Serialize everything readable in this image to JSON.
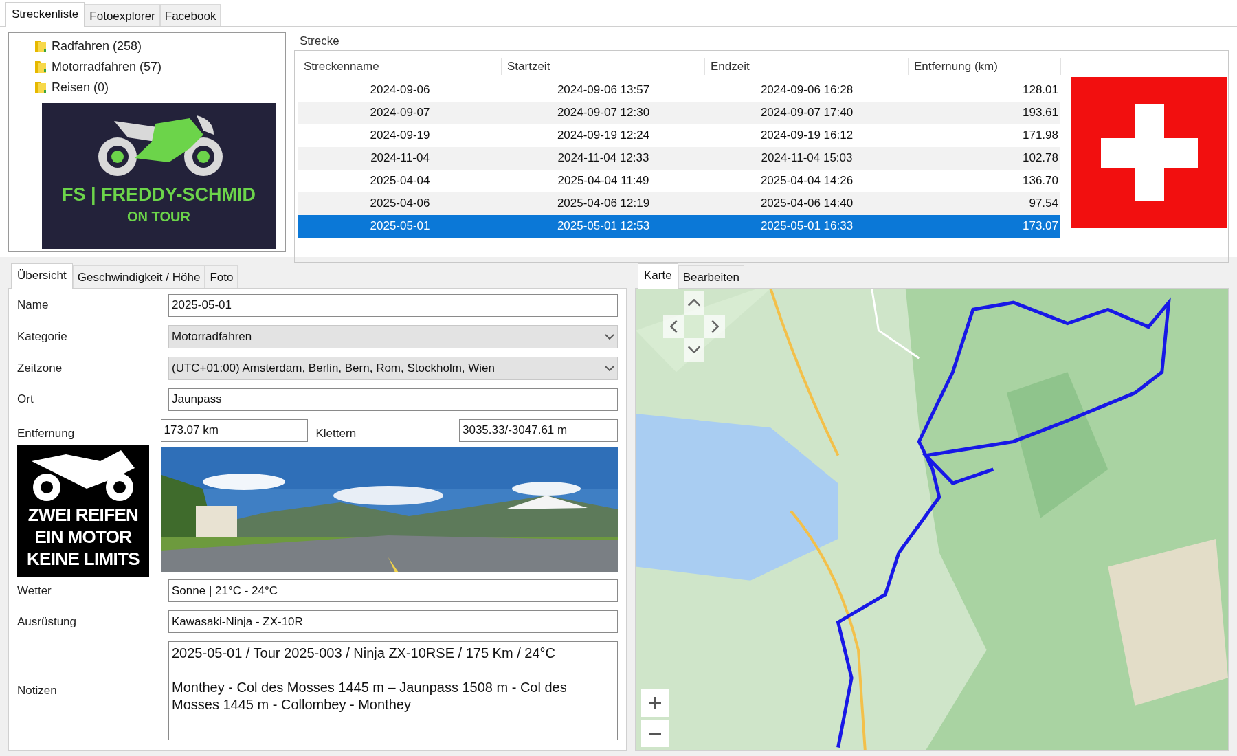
{
  "main_tabs": [
    {
      "label": "Streckenliste",
      "selected": true
    },
    {
      "label": "Fotoexplorer",
      "selected": false
    },
    {
      "label": "Facebook",
      "selected": false
    }
  ],
  "tree": {
    "items": [
      {
        "label": "Radfahren (258)"
      },
      {
        "label": "Motorradfahren (57)"
      },
      {
        "label": "Reisen (0)"
      }
    ]
  },
  "logo": {
    "title": "FS | FREDDY-SCHMID",
    "subtitle": "ON TOUR"
  },
  "strecke": {
    "title": "Strecke",
    "columns": [
      "Streckenname",
      "Startzeit",
      "Endzeit",
      "Entfernung (km)"
    ],
    "rows": [
      {
        "cells": [
          "2024-09-06",
          "2024-09-06 13:57",
          "2024-09-06 16:28",
          "128.01"
        ],
        "selected": false
      },
      {
        "cells": [
          "2024-09-07",
          "2024-09-07 12:30",
          "2024-09-07 17:40",
          "193.61"
        ],
        "selected": false
      },
      {
        "cells": [
          "2024-09-19",
          "2024-09-19 12:24",
          "2024-09-19 16:12",
          "171.98"
        ],
        "selected": false
      },
      {
        "cells": [
          "2024-11-04",
          "2024-11-04 12:33",
          "2024-11-04 15:03",
          "102.78"
        ],
        "selected": false
      },
      {
        "cells": [
          "2025-04-04",
          "2025-04-04 11:49",
          "2025-04-04 14:26",
          "136.70"
        ],
        "selected": false
      },
      {
        "cells": [
          "2025-04-06",
          "2025-04-06 12:19",
          "2025-04-06 14:40",
          "97.54"
        ],
        "selected": false
      },
      {
        "cells": [
          "2025-05-01",
          "2025-05-01 12:53",
          "2025-05-01 16:33",
          "173.07"
        ],
        "selected": true
      }
    ]
  },
  "detail_tabs": [
    {
      "label": "Übersicht",
      "selected": true
    },
    {
      "label": "Geschwindigkeit / Höhe",
      "selected": false
    },
    {
      "label": "Foto",
      "selected": false
    }
  ],
  "form": {
    "name": {
      "label": "Name",
      "value": "2025-05-01"
    },
    "kategorie": {
      "label": "Kategorie",
      "value": "Motorradfahren"
    },
    "zeitzone": {
      "label": "Zeitzone",
      "value": "(UTC+01:00) Amsterdam, Berlin, Bern, Rom, Stockholm, Wien"
    },
    "ort": {
      "label": "Ort",
      "value": "Jaunpass"
    },
    "entfernung": {
      "label": "Entfernung",
      "value": "173.07 km"
    },
    "klettern": {
      "label": "Klettern",
      "value": "3035.33/-3047.61 m"
    },
    "sticker": [
      "ZWEI REIFEN",
      "EIN MOTOR",
      "KEINE LIMITS"
    ],
    "wetter": {
      "label": "Wetter",
      "value": "Sonne | 21°C - 24°C"
    },
    "ausruestung": {
      "label": "Ausrüstung",
      "value": "Kawasaki-Ninja - ZX-10R"
    },
    "notizen": {
      "label": "Notizen",
      "value": "2025-05-01 / Tour 2025-003 / Ninja ZX-10RSE / 175 Km / 24°C\n\nMonthey - Col des Mosses 1445 m – Jaunpass 1508 m - Col des Mosses 1445 m - Collombey - Monthey"
    }
  },
  "map_tabs": [
    {
      "label": "Karte",
      "selected": true
    },
    {
      "label": "Bearbeiten",
      "selected": false
    }
  ]
}
